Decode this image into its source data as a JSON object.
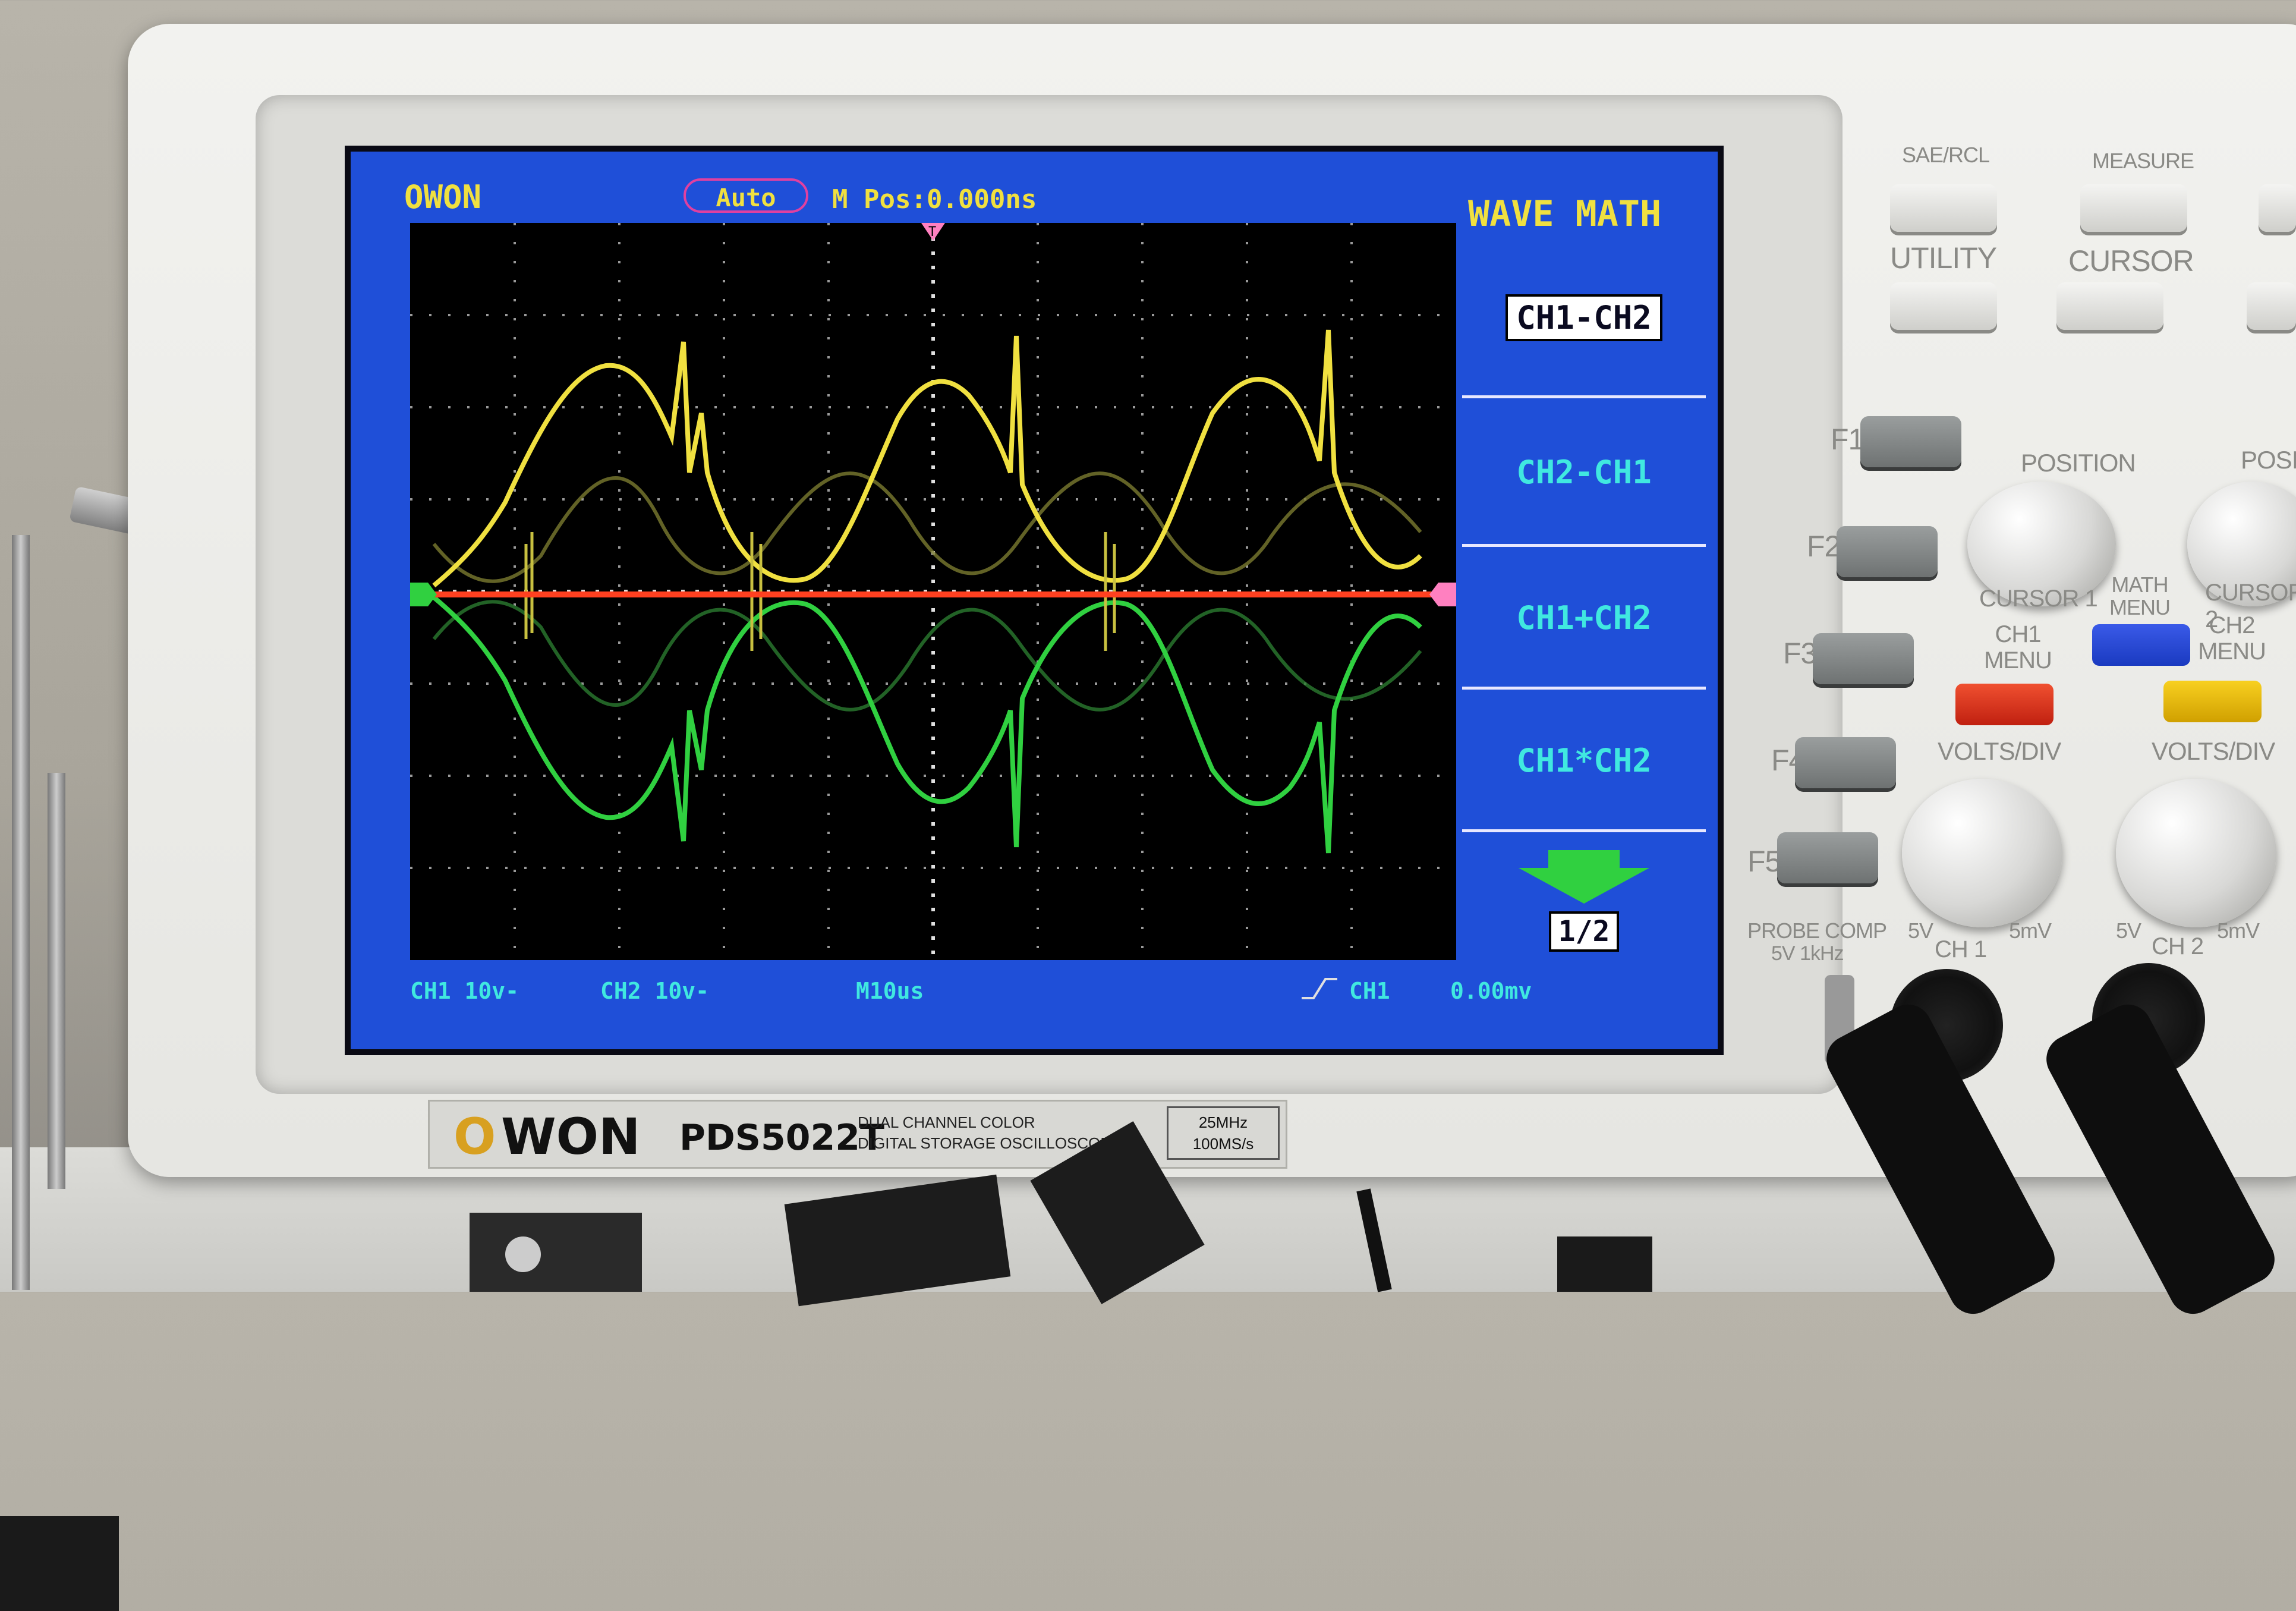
{
  "screen": {
    "brand": "OWON",
    "trigger_mode": "Auto",
    "m_pos": "M Pos:0.000ns",
    "menu_title": "WAVE MATH",
    "menu_items": [
      "CH1-CH2",
      "CH2-CH1",
      "CH1+CH2",
      "CH1*CH2"
    ],
    "page_indicator": "1/2",
    "status": {
      "ch1": "CH1 10v-",
      "ch2": "CH2 10v-",
      "timebase": "M10us",
      "trigger_source": "CH1",
      "trigger_level": "0.00mv"
    },
    "colors": {
      "ch1": "#f0e040",
      "ch2": "#30d040",
      "math": "#ff4020",
      "screen_bg": "#1f4fd8"
    }
  },
  "front_label": {
    "logo": "OWON",
    "model": "PDS5022T",
    "desc_line1": "DUAL CHANNEL COLOR",
    "desc_line2": "DIGITAL STORAGE OSCILLOSCOPE",
    "spec1": "25MHz",
    "spec2": "100MS/s"
  },
  "panel": {
    "top_buttons": [
      "SAE/RCL",
      "MEASURE",
      "UTILITY",
      "CURSOR"
    ],
    "function_keys": [
      "F1",
      "F2",
      "F3",
      "F4",
      "F5"
    ],
    "position_label": "POSITION",
    "cursor1": "CURSOR 1",
    "cursor2": "CURSOR 2",
    "math_menu": "MATH MENU",
    "ch1_menu": "CH1 MENU",
    "ch2_menu": "CH2 MENU",
    "volts_div": "VOLTS/DIV",
    "probe_comp": "PROBE COMP",
    "probe_comp_spec": "5V 1kHz",
    "range_hi": "5V",
    "range_lo": "5mV",
    "ch1_label": "CH 1",
    "ch2_label": "CH 2"
  }
}
